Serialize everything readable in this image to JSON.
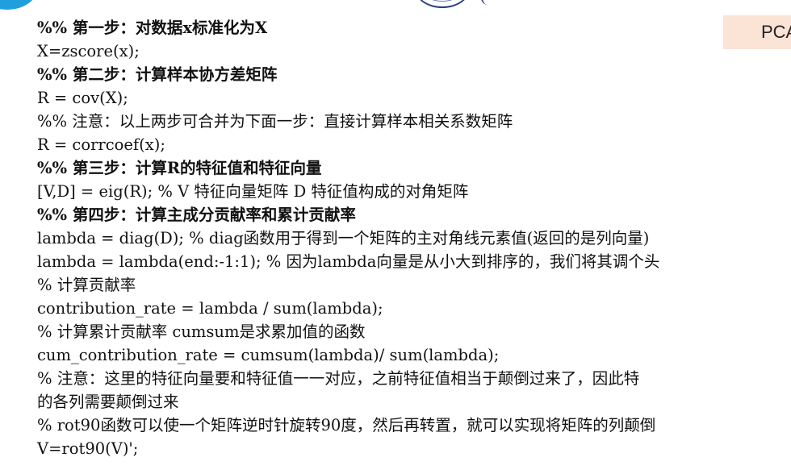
{
  "header": {
    "tag_label": "PCA"
  },
  "lines": [
    {
      "text": "%% 第一步：对数据x标准化为X",
      "bold": true
    },
    {
      "text": "X=zscore(x);",
      "bold": false
    },
    {
      "text": "%% 第二步：计算样本协方差矩阵",
      "bold": true
    },
    {
      "text": "R = cov(X);",
      "bold": false
    },
    {
      "text": "%% 注意：以上两步可合并为下面一步：直接计算样本相关系数矩阵",
      "bold": false
    },
    {
      "text": "R = corrcoef(x);",
      "bold": false
    },
    {
      "text": "%% 第三步：计算R的特征值和特征向量",
      "bold": true
    },
    {
      "text": "[V,D] = eig(R); % V 特征向量矩阵  D 特征值构成的对角矩阵",
      "bold": false
    },
    {
      "text": "%% 第四步：计算主成分贡献率和累计贡献率",
      "bold": true
    },
    {
      "text": "lambda = diag(D); % diag函数用于得到一个矩阵的主对角线元素值(返回的是列向量)",
      "bold": false
    },
    {
      "text": "lambda = lambda(end:-1:1); % 因为lambda向量是从小大到排序的，我们将其调个头",
      "bold": false
    },
    {
      "text": "% 计算贡献率",
      "bold": false
    },
    {
      "text": "contribution_rate = lambda / sum(lambda);",
      "bold": false
    },
    {
      "text": "% 计算累计贡献率  cumsum是求累加值的函数",
      "bold": false
    },
    {
      "text": "cum_contribution_rate = cumsum(lambda)/ sum(lambda);",
      "bold": false
    },
    {
      "text": "% 注意：这里的特征向量要和特征值一一对应，之前特征值相当于颠倒过来了，因此特",
      "bold": false
    },
    {
      "text": "的各列需要颠倒过来",
      "bold": false
    },
    {
      "text": "% rot90函数可以使一个矩阵逆时针旋转90度，然后再转置，就可以实现将矩阵的列颠倒",
      "bold": false
    },
    {
      "text": "V=rot90(V)';",
      "bold": false
    }
  ]
}
